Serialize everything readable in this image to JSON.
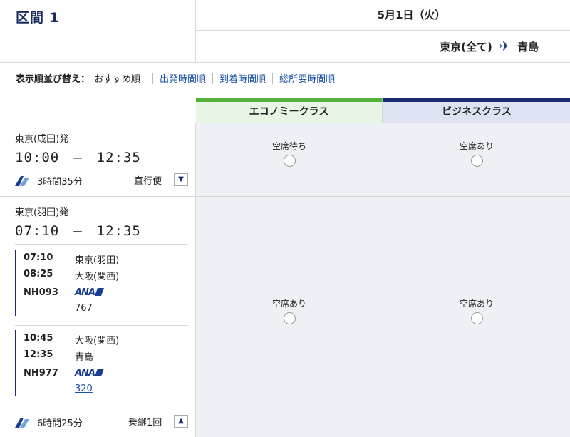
{
  "header": {
    "section_title": "区間 1",
    "date": "5月1日（火）",
    "origin": "東京(全て)",
    "destination": "青島"
  },
  "sort": {
    "label": "表示順並び替え：",
    "current": "おすすめ順",
    "options": [
      "出発時間順",
      "到着時間順",
      "総所要時間順"
    ]
  },
  "classes": {
    "economy": "エコノミークラス",
    "business": "ビジネスクラス"
  },
  "flights": [
    {
      "departure_airport": "東京(成田)発",
      "times": "10:00　—　12:35",
      "duration": "3時間35分",
      "type": "直行便",
      "economy": "空席待ち",
      "business": "空席あり"
    },
    {
      "departure_airport": "東京(羽田)発",
      "times": "07:10　—　12:35",
      "duration": "6時間25分",
      "type": "乗継1回",
      "economy": "空席あり",
      "business": "空席あり",
      "segments": [
        {
          "dep_time": "07:10",
          "dep_airport": "東京(羽田)",
          "arr_time": "08:25",
          "arr_airport": "大阪(関西)",
          "flight_no": "NH093",
          "airline": "ANA",
          "aircraft": "767"
        },
        {
          "dep_time": "10:45",
          "dep_airport": "大阪(関西)",
          "arr_time": "12:35",
          "arr_airport": "青島",
          "flight_no": "NH977",
          "airline": "ANA",
          "aircraft": "320"
        }
      ]
    }
  ]
}
